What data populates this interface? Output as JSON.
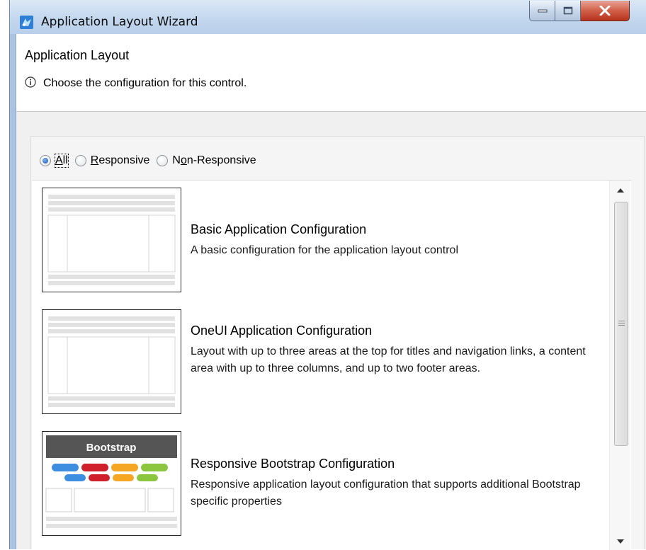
{
  "window": {
    "title": "Application Layout Wizard",
    "icons": {
      "app": "app-icon",
      "minimize": "minimize-icon",
      "maximize": "maximize-icon",
      "close": "close-icon"
    }
  },
  "header": {
    "title": "Application Layout",
    "description": "Choose the configuration for this control.",
    "info_icon": "info-icon"
  },
  "filter": {
    "options": [
      {
        "label_pre": "",
        "label_u": "A",
        "label_post": "ll",
        "selected": true
      },
      {
        "label_pre": "",
        "label_u": "R",
        "label_post": "esponsive",
        "selected": false
      },
      {
        "label_pre": "N",
        "label_u": "o",
        "label_post": "n-Responsive",
        "selected": false
      }
    ]
  },
  "configurations": [
    {
      "title": "Basic Application Configuration",
      "description": "A basic configuration for the application layout control",
      "preview": "basic"
    },
    {
      "title": "OneUI Application Configuration",
      "description": "Layout with up to three areas at the top for titles and navigation links, a content area with up to three columns, and up to two footer areas.",
      "preview": "oneui"
    },
    {
      "title": "Responsive Bootstrap Configuration",
      "description": "Responsive application layout configuration that supports additional Bootstrap specific properties",
      "preview": "bootstrap",
      "preview_label": "Bootstrap"
    }
  ],
  "colors": {
    "bootstrap_header": "#555555",
    "pill_blue": "#3d8de0",
    "pill_red": "#d0202c",
    "pill_orange": "#f5a623",
    "pill_green": "#8cc63e"
  }
}
